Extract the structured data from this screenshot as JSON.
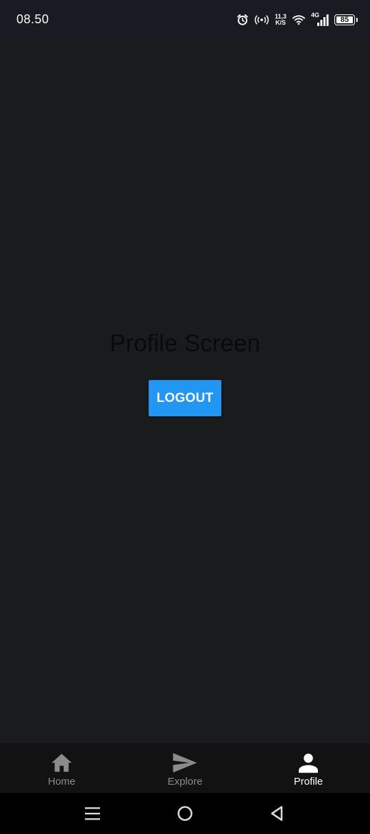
{
  "status_bar": {
    "time": "08.50",
    "speed_value": "11,3",
    "speed_unit": "K/S",
    "network_type": "4G",
    "battery": "85",
    "icons": [
      "alarm-icon",
      "hotspot-icon",
      "wifi-icon",
      "signal-icon",
      "battery-icon"
    ]
  },
  "main": {
    "title": "Profile Screen",
    "logout_label": "LOGOUT"
  },
  "tabs": [
    {
      "label": "Home",
      "icon": "home-icon",
      "active": false
    },
    {
      "label": "Explore",
      "icon": "send-icon",
      "active": false
    },
    {
      "label": "Profile",
      "icon": "person-icon",
      "active": true
    }
  ],
  "nav_bar": {
    "buttons": [
      "menu-icon",
      "home-circle-icon",
      "back-triangle-icon"
    ]
  },
  "colors": {
    "background": "#1a1b1d",
    "status_bar": "#181b21",
    "tab_bar": "#121212",
    "accent": "#2196f3",
    "tab_active": "#ffffff",
    "tab_inactive": "#8b8b8b"
  }
}
